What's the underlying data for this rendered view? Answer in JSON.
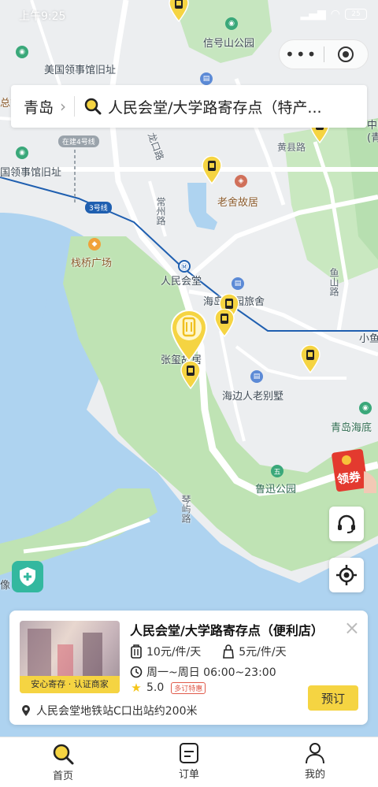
{
  "status_bar": {
    "time": "上午9:25",
    "battery": "25"
  },
  "capsule": {
    "more_label": "•••"
  },
  "search": {
    "city": "青岛",
    "query": "人民会堂/大学路寄存点（特产..."
  },
  "map": {
    "labels": {
      "xinhao_park": "信号山公园",
      "us_consulate": "美国领事馆旧址",
      "consulate_2": "国领事馆旧址",
      "zong": "总督",
      "longkou_road": "龙口路",
      "huangxian_road": "黄县路",
      "laoshe": "老舍故居",
      "changzhou_road": "常州路",
      "zhanqiao": "栈桥广场",
      "renmin_huitang": "人民会堂",
      "inn": "海岛花园旅舍",
      "yushan_road": "鱼山路",
      "xiaoyu": "小鱼",
      "zhang_residence": "张玺故居",
      "villa": "海边人老别墅",
      "qingdao_haidi": "青岛海底",
      "luxun_park": "鲁迅公园",
      "qinyu_road": "琴屿路",
      "coast_xiang": "像",
      "zhongguo": "中国",
      "zhongguo_2": "(青"
    },
    "line_tags": {
      "metro_3": "3号线",
      "metro_4": "在建4号线"
    }
  },
  "coupon": {
    "label": "领券"
  },
  "card": {
    "title": "人民会堂/大学路寄存点（便利店）",
    "badge": "安心寄存 · 认证商家",
    "price_big": "10元/件/天",
    "price_small": "5元/件/天",
    "hours": "周一~周日 06:00~23:00",
    "rating": "5.0",
    "rating_tag": "多订特惠",
    "location": "人民会堂地铁站C口出站约200米",
    "book_button": "预订"
  },
  "tabbar": {
    "home": "首页",
    "orders": "订单",
    "mine": "我的"
  },
  "colors": {
    "accent": "#f5d442",
    "water": "#aed3f0",
    "park": "#bfe3b4",
    "metro": "#1f5fb0",
    "teal": "#33b89f"
  }
}
